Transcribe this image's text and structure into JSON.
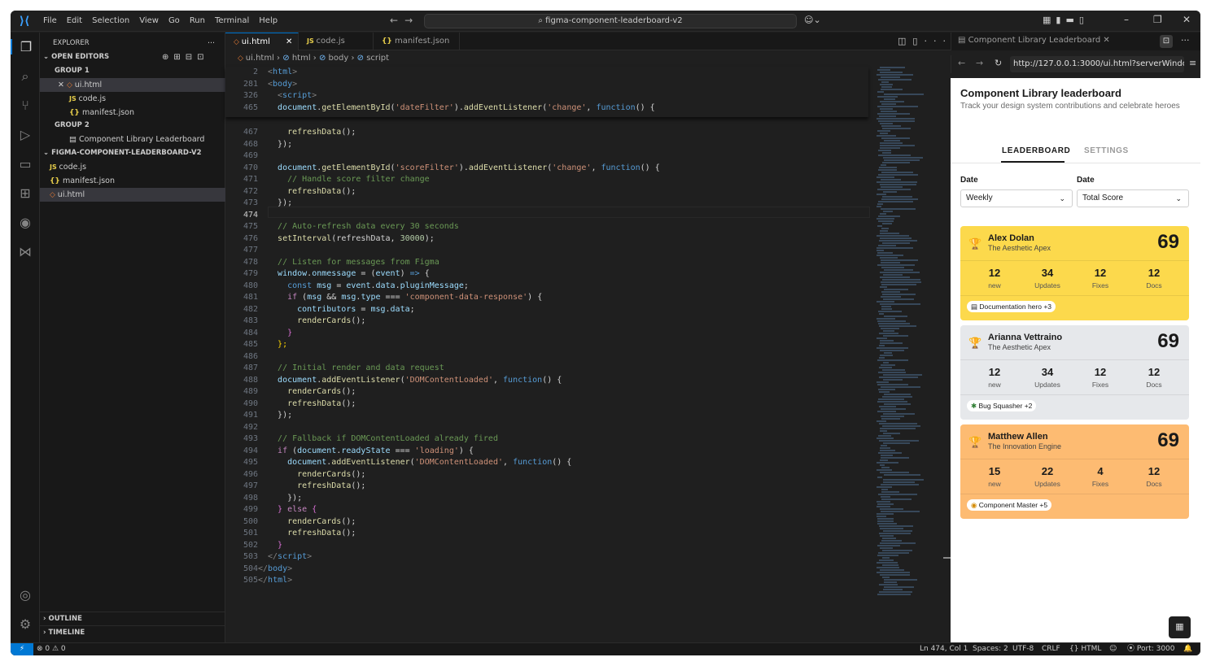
{
  "title_bar": {
    "menu": [
      "File",
      "Edit",
      "Selection",
      "View",
      "Go",
      "Run",
      "Terminal",
      "Help"
    ],
    "search": "figma-component-leaderboard-v2"
  },
  "explorer": {
    "title": "EXPLORER",
    "open_editors_label": "OPEN EDITORS",
    "group1": "GROUP 1",
    "group1_files": [
      "ui.html",
      "code.js",
      "manifest.json"
    ],
    "group2": "GROUP 2",
    "group2_files": [
      "Component Library Leaderboard"
    ],
    "project": "FIGMA-COMPONENT-LEADERBOARD-V2",
    "project_files": [
      "code.js",
      "manifest.json",
      "ui.html"
    ],
    "outline": "OUTLINE",
    "timeline": "TIMELINE"
  },
  "editor": {
    "tabs": [
      "ui.html",
      "code.js",
      "manifest.json"
    ],
    "breadcrumb": [
      "ui.html",
      "html",
      "body",
      "script"
    ]
  },
  "browser": {
    "tab": "Component Library Leaderboard",
    "url": "http://127.0.0.1:3000/ui.html?serverWindowId"
  },
  "plugin": {
    "title": "Component Library leaderboard",
    "subtitle": "Track your design system contributions and celebrate heroes",
    "tabs": [
      "LEADERBOARD",
      "SETTINGS"
    ],
    "filters": [
      {
        "label": "Date",
        "value": "Weekly"
      },
      {
        "label": "Date",
        "value": "Total Score"
      }
    ],
    "stat_labels": [
      "new",
      "Updates",
      "Fixes",
      "Docs"
    ],
    "cards": [
      {
        "name": "Alex Dolan",
        "team": "The Aesthetic Apex",
        "score": "69",
        "stats": [
          "12",
          "34",
          "12",
          "12"
        ],
        "badge": "Documentation hero +3",
        "color": "#fcd94c"
      },
      {
        "name": "Arianna Vettraino",
        "team": "The Aesthetic Apex",
        "score": "69",
        "stats": [
          "12",
          "34",
          "12",
          "12"
        ],
        "badge": "Bug Squasher +2",
        "color": "#e6e8eb"
      },
      {
        "name": "Matthew Allen",
        "team": "The Innovation Engine",
        "score": "69",
        "stats": [
          "15",
          "22",
          "4",
          "12"
        ],
        "badge": "Component Master +5",
        "color": "#fdbb72"
      }
    ]
  },
  "status_bar": {
    "problems": "⊗ 0 ⚠ 0",
    "position": "Ln 474, Col 1",
    "spaces": "Spaces: 2",
    "encoding": "UTF-8",
    "eol": "CRLF",
    "language": "{} HTML",
    "port": "Port: 3000"
  },
  "icons": {
    "activity": [
      "explorer-icon",
      "search-icon",
      "source-control-icon",
      "run-debug-icon",
      "remote-explorer-icon",
      "extensions-icon",
      "github-icon",
      "test-icon",
      "account-icon",
      "settings-icon"
    ]
  }
}
